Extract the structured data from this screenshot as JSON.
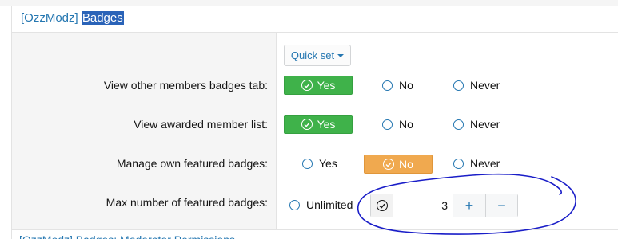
{
  "header": {
    "prefix": "[OzzModz]",
    "title": "Badges"
  },
  "quick_set": {
    "label": "Quick set"
  },
  "rows": [
    {
      "label": "View other members badges tab:",
      "options": [
        "Yes",
        "No",
        "Never"
      ],
      "selected": "Yes",
      "selected_color": "#3fb24a"
    },
    {
      "label": "View awarded member list:",
      "options": [
        "Yes",
        "No",
        "Never"
      ],
      "selected": "Yes",
      "selected_color": "#3fb24a"
    },
    {
      "label": "Manage own featured badges:",
      "options": [
        "Yes",
        "No",
        "Never"
      ],
      "selected": "No",
      "selected_color": "#f0a94f"
    }
  ],
  "max_featured": {
    "label": "Max number of featured badges:",
    "unlimited_label": "Unlimited",
    "value": "3",
    "increment_label": "+",
    "decrement_label": "−"
  },
  "next_section_peek": "[OzzModz] Badges: Moderator Permissions",
  "icons": {
    "check": "check-circle-icon",
    "radio": "radio-icon",
    "caret": "caret-down-icon"
  },
  "colors": {
    "link": "#2577b1",
    "selected_yes": "#3fb24a",
    "selected_no": "#f0a94f",
    "annotation_ink": "#1a1ec8"
  }
}
